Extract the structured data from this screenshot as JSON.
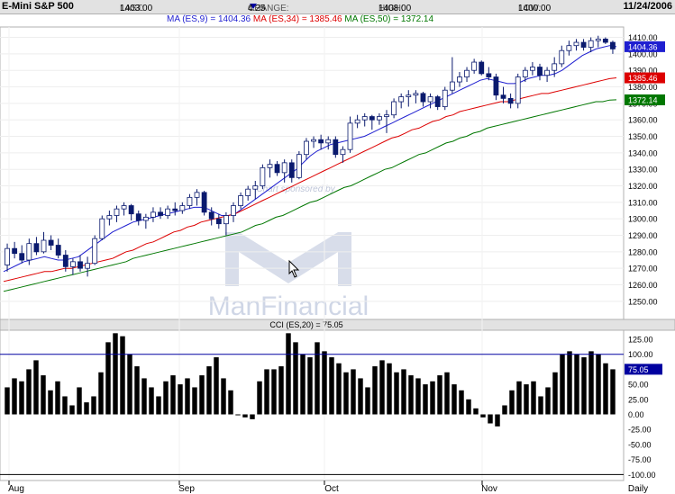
{
  "header": {
    "title": "E-Mini S&P 500",
    "last_label": "LAST:",
    "last_value": "1403.00",
    "change_label": "CHANGE:",
    "change_value": "4.25",
    "high_label": "HIGH:",
    "high_value": "1408.00",
    "low_label": "LOW:",
    "low_value": "1400.00",
    "date": "11/24/2006"
  },
  "ma_legend": {
    "ma9": "MA (ES,9) = 1404.36",
    "ma34": "MA (ES,34) = 1385.46",
    "ma50": "MA (ES,50) = 1372.14"
  },
  "colors": {
    "ma9": "#1f1fd0",
    "ma34": "#dd0000",
    "ma50": "#007700",
    "up_candle": "#ffffff",
    "down_candle": "#0a1a6e",
    "cci_bar": "#000000"
  },
  "watermark": {
    "line1": "Chart sponsored by",
    "brand": "ManFinancial"
  },
  "chart_data": [
    {
      "type": "candlestick",
      "ylim": [
        1240,
        1415
      ],
      "y_ticks": [
        "1250.00",
        "1260.00",
        "1270.00",
        "1280.00",
        "1290.00",
        "1300.00",
        "1310.00",
        "1320.00",
        "1330.00",
        "1340.00",
        "1350.00",
        "1360.00",
        "1370.00",
        "1380.00",
        "1390.00",
        "1400.00",
        "1410.00"
      ],
      "x_ticks": [
        "Aug",
        "Sep",
        "Oct",
        "Nov",
        "Daily"
      ],
      "value_tags": [
        {
          "label": "1404.36",
          "value": 1404.36,
          "color": "#1f1fd0"
        },
        {
          "label": "1385.46",
          "value": 1385.46,
          "color": "#dd0000"
        },
        {
          "label": "1372.14",
          "value": 1372.14,
          "color": "#007700"
        }
      ],
      "series": [
        {
          "name": "MA (ES,9)",
          "values": [
            1268,
            1270,
            1272,
            1274,
            1275,
            1276,
            1277,
            1276,
            1275,
            1275,
            1276,
            1277,
            1280,
            1283,
            1286,
            1289,
            1292,
            1294,
            1296,
            1298,
            1299,
            1300,
            1301,
            1302,
            1303,
            1304,
            1305,
            1306,
            1307,
            1307,
            1306,
            1304,
            1302,
            1302,
            1303,
            1306,
            1309,
            1312,
            1315,
            1318,
            1321,
            1324,
            1327,
            1330,
            1334,
            1338,
            1341,
            1343,
            1345,
            1346,
            1347,
            1348,
            1349,
            1350,
            1352,
            1354,
            1356,
            1358,
            1360,
            1362,
            1364,
            1366,
            1368,
            1370,
            1372,
            1374,
            1376,
            1378,
            1380,
            1382,
            1384,
            1385,
            1384,
            1383,
            1382,
            1382,
            1383,
            1385,
            1386,
            1387,
            1387,
            1388,
            1390,
            1393,
            1396,
            1399,
            1401,
            1403,
            1404,
            1405,
            1404.36
          ]
        },
        {
          "name": "MA (ES,34)",
          "values": [
            1262,
            1263,
            1264,
            1265,
            1266,
            1267,
            1268,
            1268,
            1269,
            1270,
            1270,
            1271,
            1272,
            1273,
            1274,
            1275,
            1276,
            1278,
            1280,
            1281,
            1283,
            1285,
            1286,
            1288,
            1290,
            1292,
            1293,
            1295,
            1296,
            1298,
            1299,
            1300,
            1301,
            1302,
            1303,
            1305,
            1307,
            1309,
            1311,
            1313,
            1315,
            1317,
            1319,
            1321,
            1323,
            1325,
            1327,
            1329,
            1331,
            1333,
            1335,
            1337,
            1339,
            1341,
            1343,
            1345,
            1347,
            1349,
            1350,
            1352,
            1354,
            1355,
            1357,
            1359,
            1360,
            1362,
            1363,
            1365,
            1366,
            1367,
            1368,
            1369,
            1370,
            1371,
            1371,
            1372,
            1373,
            1374,
            1375,
            1376,
            1376,
            1377,
            1378,
            1379,
            1380,
            1381,
            1382,
            1383,
            1384,
            1385,
            1385.46
          ]
        },
        {
          "name": "MA (ES,50)",
          "values": [
            1256,
            1257,
            1258,
            1259,
            1260,
            1261,
            1262,
            1263,
            1264,
            1265,
            1266,
            1267,
            1268,
            1269,
            1270,
            1271,
            1272,
            1273,
            1274,
            1276,
            1277,
            1278,
            1279,
            1280,
            1281,
            1282,
            1283,
            1284,
            1285,
            1286,
            1287,
            1288,
            1289,
            1290,
            1291,
            1292,
            1294,
            1296,
            1297,
            1299,
            1301,
            1302,
            1304,
            1306,
            1308,
            1310,
            1311,
            1313,
            1315,
            1317,
            1319,
            1320,
            1322,
            1324,
            1326,
            1328,
            1330,
            1331,
            1333,
            1335,
            1337,
            1339,
            1340,
            1342,
            1344,
            1346,
            1347,
            1349,
            1350,
            1352,
            1353,
            1355,
            1356,
            1357,
            1358,
            1359,
            1360,
            1361,
            1362,
            1363,
            1364,
            1365,
            1366,
            1367,
            1368,
            1369,
            1370,
            1371,
            1371,
            1372,
            1372.14
          ]
        }
      ],
      "candles": [
        {
          "o": 1272,
          "h": 1285,
          "l": 1268,
          "c": 1282
        },
        {
          "o": 1282,
          "h": 1286,
          "l": 1276,
          "c": 1279
        },
        {
          "o": 1279,
          "h": 1284,
          "l": 1273,
          "c": 1275
        },
        {
          "o": 1275,
          "h": 1288,
          "l": 1272,
          "c": 1285
        },
        {
          "o": 1285,
          "h": 1289,
          "l": 1278,
          "c": 1280
        },
        {
          "o": 1280,
          "h": 1292,
          "l": 1279,
          "c": 1287
        },
        {
          "o": 1287,
          "h": 1290,
          "l": 1281,
          "c": 1284
        },
        {
          "o": 1284,
          "h": 1288,
          "l": 1276,
          "c": 1278
        },
        {
          "o": 1278,
          "h": 1281,
          "l": 1268,
          "c": 1271
        },
        {
          "o": 1271,
          "h": 1276,
          "l": 1266,
          "c": 1274
        },
        {
          "o": 1274,
          "h": 1278,
          "l": 1268,
          "c": 1270
        },
        {
          "o": 1270,
          "h": 1277,
          "l": 1265,
          "c": 1273
        },
        {
          "o": 1273,
          "h": 1290,
          "l": 1272,
          "c": 1288
        },
        {
          "o": 1288,
          "h": 1302,
          "l": 1287,
          "c": 1300
        },
        {
          "o": 1300,
          "h": 1305,
          "l": 1296,
          "c": 1302
        },
        {
          "o": 1302,
          "h": 1308,
          "l": 1298,
          "c": 1306
        },
        {
          "o": 1306,
          "h": 1310,
          "l": 1302,
          "c": 1308
        },
        {
          "o": 1308,
          "h": 1309,
          "l": 1299,
          "c": 1303
        },
        {
          "o": 1303,
          "h": 1305,
          "l": 1296,
          "c": 1299
        },
        {
          "o": 1299,
          "h": 1303,
          "l": 1294,
          "c": 1301
        },
        {
          "o": 1301,
          "h": 1307,
          "l": 1298,
          "c": 1304
        },
        {
          "o": 1304,
          "h": 1307,
          "l": 1300,
          "c": 1302
        },
        {
          "o": 1302,
          "h": 1308,
          "l": 1300,
          "c": 1306
        },
        {
          "o": 1306,
          "h": 1310,
          "l": 1302,
          "c": 1305
        },
        {
          "o": 1305,
          "h": 1310,
          "l": 1303,
          "c": 1308
        },
        {
          "o": 1308,
          "h": 1315,
          "l": 1306,
          "c": 1313
        },
        {
          "o": 1313,
          "h": 1318,
          "l": 1308,
          "c": 1316
        },
        {
          "o": 1316,
          "h": 1317,
          "l": 1302,
          "c": 1304
        },
        {
          "o": 1304,
          "h": 1307,
          "l": 1296,
          "c": 1300
        },
        {
          "o": 1300,
          "h": 1303,
          "l": 1294,
          "c": 1297
        },
        {
          "o": 1297,
          "h": 1304,
          "l": 1290,
          "c": 1302
        },
        {
          "o": 1302,
          "h": 1310,
          "l": 1298,
          "c": 1308
        },
        {
          "o": 1308,
          "h": 1316,
          "l": 1306,
          "c": 1314
        },
        {
          "o": 1314,
          "h": 1320,
          "l": 1311,
          "c": 1318
        },
        {
          "o": 1318,
          "h": 1323,
          "l": 1312,
          "c": 1320
        },
        {
          "o": 1320,
          "h": 1333,
          "l": 1318,
          "c": 1331
        },
        {
          "o": 1331,
          "h": 1336,
          "l": 1325,
          "c": 1333
        },
        {
          "o": 1333,
          "h": 1335,
          "l": 1326,
          "c": 1328
        },
        {
          "o": 1328,
          "h": 1336,
          "l": 1322,
          "c": 1334
        },
        {
          "o": 1334,
          "h": 1336,
          "l": 1322,
          "c": 1325
        },
        {
          "o": 1325,
          "h": 1341,
          "l": 1324,
          "c": 1339
        },
        {
          "o": 1339,
          "h": 1349,
          "l": 1336,
          "c": 1347
        },
        {
          "o": 1347,
          "h": 1350,
          "l": 1343,
          "c": 1348
        },
        {
          "o": 1348,
          "h": 1351,
          "l": 1342,
          "c": 1346
        },
        {
          "o": 1346,
          "h": 1350,
          "l": 1342,
          "c": 1348
        },
        {
          "o": 1348,
          "h": 1350,
          "l": 1337,
          "c": 1339
        },
        {
          "o": 1339,
          "h": 1344,
          "l": 1334,
          "c": 1342
        },
        {
          "o": 1342,
          "h": 1362,
          "l": 1340,
          "c": 1358
        },
        {
          "o": 1358,
          "h": 1363,
          "l": 1355,
          "c": 1360
        },
        {
          "o": 1360,
          "h": 1364,
          "l": 1356,
          "c": 1362
        },
        {
          "o": 1362,
          "h": 1363,
          "l": 1354,
          "c": 1360
        },
        {
          "o": 1360,
          "h": 1364,
          "l": 1357,
          "c": 1362
        },
        {
          "o": 1362,
          "h": 1366,
          "l": 1352,
          "c": 1363
        },
        {
          "o": 1363,
          "h": 1373,
          "l": 1361,
          "c": 1371
        },
        {
          "o": 1371,
          "h": 1376,
          "l": 1367,
          "c": 1374
        },
        {
          "o": 1374,
          "h": 1378,
          "l": 1368,
          "c": 1375
        },
        {
          "o": 1375,
          "h": 1378,
          "l": 1370,
          "c": 1376
        },
        {
          "o": 1376,
          "h": 1377,
          "l": 1368,
          "c": 1371
        },
        {
          "o": 1371,
          "h": 1376,
          "l": 1367,
          "c": 1374
        },
        {
          "o": 1374,
          "h": 1375,
          "l": 1366,
          "c": 1368
        },
        {
          "o": 1368,
          "h": 1380,
          "l": 1366,
          "c": 1378
        },
        {
          "o": 1378,
          "h": 1398,
          "l": 1376,
          "c": 1383
        },
        {
          "o": 1383,
          "h": 1389,
          "l": 1380,
          "c": 1386
        },
        {
          "o": 1386,
          "h": 1392,
          "l": 1383,
          "c": 1390
        },
        {
          "o": 1390,
          "h": 1397,
          "l": 1388,
          "c": 1395
        },
        {
          "o": 1395,
          "h": 1396,
          "l": 1387,
          "c": 1388
        },
        {
          "o": 1388,
          "h": 1392,
          "l": 1384,
          "c": 1386
        },
        {
          "o": 1386,
          "h": 1388,
          "l": 1372,
          "c": 1375
        },
        {
          "o": 1375,
          "h": 1380,
          "l": 1370,
          "c": 1373
        },
        {
          "o": 1373,
          "h": 1376,
          "l": 1367,
          "c": 1370
        },
        {
          "o": 1370,
          "h": 1388,
          "l": 1367,
          "c": 1386
        },
        {
          "o": 1386,
          "h": 1392,
          "l": 1383,
          "c": 1390
        },
        {
          "o": 1390,
          "h": 1395,
          "l": 1387,
          "c": 1392
        },
        {
          "o": 1392,
          "h": 1394,
          "l": 1384,
          "c": 1387
        },
        {
          "o": 1387,
          "h": 1392,
          "l": 1383,
          "c": 1390
        },
        {
          "o": 1390,
          "h": 1398,
          "l": 1386,
          "c": 1394
        },
        {
          "o": 1394,
          "h": 1405,
          "l": 1392,
          "c": 1402
        },
        {
          "o": 1402,
          "h": 1408,
          "l": 1399,
          "c": 1405
        },
        {
          "o": 1405,
          "h": 1409,
          "l": 1402,
          "c": 1407
        },
        {
          "o": 1407,
          "h": 1409,
          "l": 1402,
          "c": 1404
        },
        {
          "o": 1404,
          "h": 1410,
          "l": 1401,
          "c": 1408
        },
        {
          "o": 1408,
          "h": 1411,
          "l": 1404,
          "c": 1409
        },
        {
          "o": 1409,
          "h": 1410,
          "l": 1406,
          "c": 1407
        },
        {
          "o": 1407,
          "h": 1408,
          "l": 1400,
          "c": 1403
        }
      ]
    },
    {
      "type": "bar",
      "title": "CCI (ES,20) = 75.05",
      "ylim": [
        -110,
        140
      ],
      "y_ticks": [
        "125.00",
        "100.00",
        "75.05",
        "50.00",
        "25.00",
        "0.00",
        "-25.00",
        "-50.00",
        "-75.00",
        "-100.00"
      ],
      "current_value": 75.05,
      "reference_lines": [
        100,
        -100
      ],
      "values": [
        45,
        60,
        55,
        75,
        90,
        65,
        40,
        55,
        30,
        15,
        45,
        20,
        30,
        70,
        120,
        135,
        130,
        100,
        80,
        60,
        45,
        30,
        55,
        65,
        50,
        60,
        45,
        65,
        80,
        95,
        60,
        40,
        0,
        -5,
        -8,
        55,
        75,
        75,
        80,
        135,
        120,
        100,
        95,
        120,
        105,
        95,
        85,
        70,
        75,
        60,
        45,
        80,
        90,
        85,
        70,
        75,
        65,
        60,
        50,
        55,
        65,
        70,
        50,
        40,
        25,
        10,
        -5,
        -15,
        -20,
        15,
        40,
        55,
        50,
        55,
        30,
        45,
        70,
        100,
        105,
        100,
        95,
        105,
        100,
        85,
        75
      ]
    }
  ]
}
